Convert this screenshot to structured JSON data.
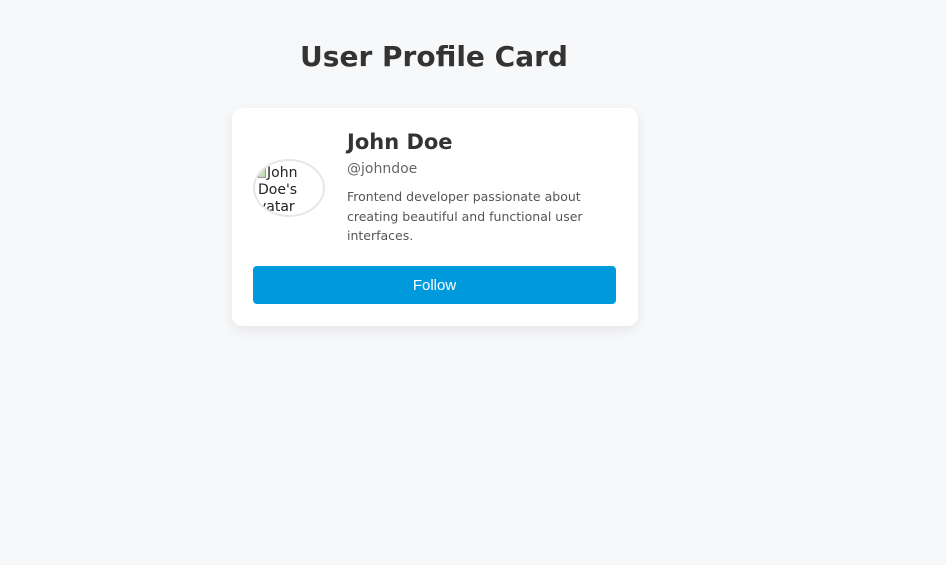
{
  "page": {
    "title": "User Profile Card"
  },
  "profile": {
    "avatar_alt": "John Doe's avatar",
    "avatar_alt_lines": [
      "John",
      "Doe's",
      "vatar"
    ],
    "name": "John Doe",
    "handle": "@johndoe",
    "bio": "Frontend developer passionate about creating beautiful and functional user interfaces."
  },
  "actions": {
    "follow_label": "Follow"
  },
  "colors": {
    "background": "#f7f8fa",
    "card": "#ffffff",
    "accent": "#0099dc",
    "title_text": "#333333",
    "muted_text": "#666666"
  }
}
